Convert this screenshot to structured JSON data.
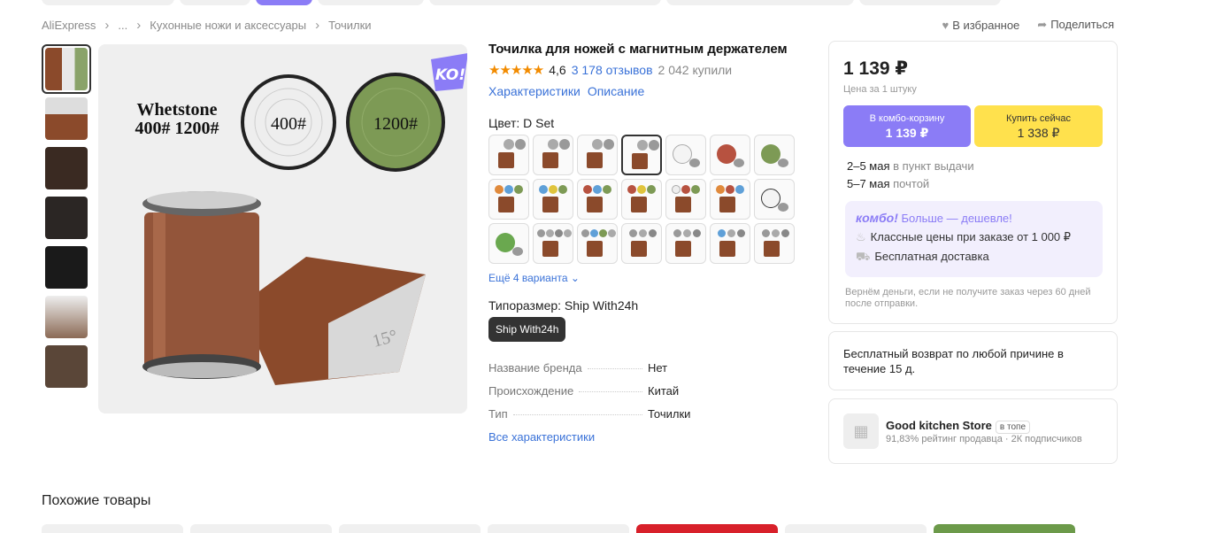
{
  "breadcrumb": [
    "AliExpress",
    "...",
    "Кухонные ножи и аксессуары",
    "Точилки"
  ],
  "top_actions": {
    "favorite": "В избранное",
    "share": "Поделиться"
  },
  "product": {
    "title": "Точилка для ножей с магнитным держателем",
    "rating": "4,6",
    "reviews": "3 178 отзывов",
    "bought": "2 042 купили",
    "tab_specs": "Характеристики",
    "tab_desc": "Описание",
    "color_label": "Цвет: D Set",
    "more_variants": "Ещё 4 варианта",
    "size_label": "Типоразмер: Ship With24h",
    "size_option": "Ship With24h",
    "image": {
      "text1": "Whetstone",
      "text2": "400# 1200#",
      "disc1": "400#",
      "disc2": "1200#",
      "angle": "15°",
      "badge": "KO!"
    }
  },
  "specs": [
    {
      "key": "Название бренда",
      "value": "Нет"
    },
    {
      "key": "Происхождение",
      "value": "Китай"
    },
    {
      "key": "Тип",
      "value": "Точилки"
    }
  ],
  "all_specs": "Все характеристики",
  "buy": {
    "price": "1 139 ₽",
    "unit": "Цена за 1 штуку",
    "combo_label": "В комбо-корзину",
    "combo_price": "1 139 ₽",
    "buy_label": "Купить сейчас",
    "buy_price": "1 338 ₽",
    "delivery1_date": "2–5 мая",
    "delivery1_rest": "в пункт выдачи",
    "delivery2_date": "5–7 мая",
    "delivery2_rest": "почтой",
    "combo_logo": "комбо!",
    "combo_head": "Больше — дешевле!",
    "combo_row1": "Классные цены при заказе от 1 000 ₽",
    "combo_row2": "Бесплатная доставка",
    "refund": "Вернём деньги, если не получите заказ через 60 дней после отправки."
  },
  "return_text": "Бесплатный возврат по любой причине в течение 15 д.",
  "store": {
    "name": "Good kitchen Store",
    "badge": "в топе",
    "sub": "91,83% рейтинг продавца · 2К подписчиков"
  },
  "similar_title": "Похожие товары",
  "colors": {
    "accent": "#8b7cf6",
    "link": "#3a72d8",
    "buy": "#ffe14d",
    "star": "#f28b00"
  }
}
